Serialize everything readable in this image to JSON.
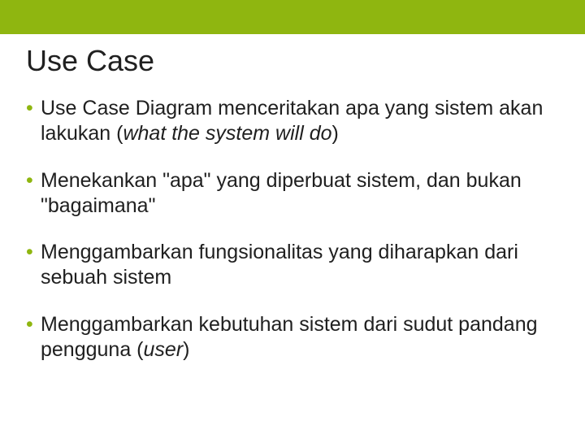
{
  "slide": {
    "title": "Use Case",
    "bullets": [
      {
        "pre": "Use Case Diagram menceritakan apa yang sistem akan lakukan (",
        "italic": "what the system will do",
        "post": ")"
      },
      {
        "pre": "Menekankan \"apa\" yang diperbuat sistem, dan bukan \"bagaimana\"",
        "italic": "",
        "post": ""
      },
      {
        "pre": "Menggambarkan fungsionalitas yang diharapkan dari sebuah sistem",
        "italic": "",
        "post": ""
      },
      {
        "pre": "Menggambarkan kebutuhan sistem dari sudut pandang pengguna (",
        "italic": "user",
        "post": ")"
      }
    ]
  }
}
